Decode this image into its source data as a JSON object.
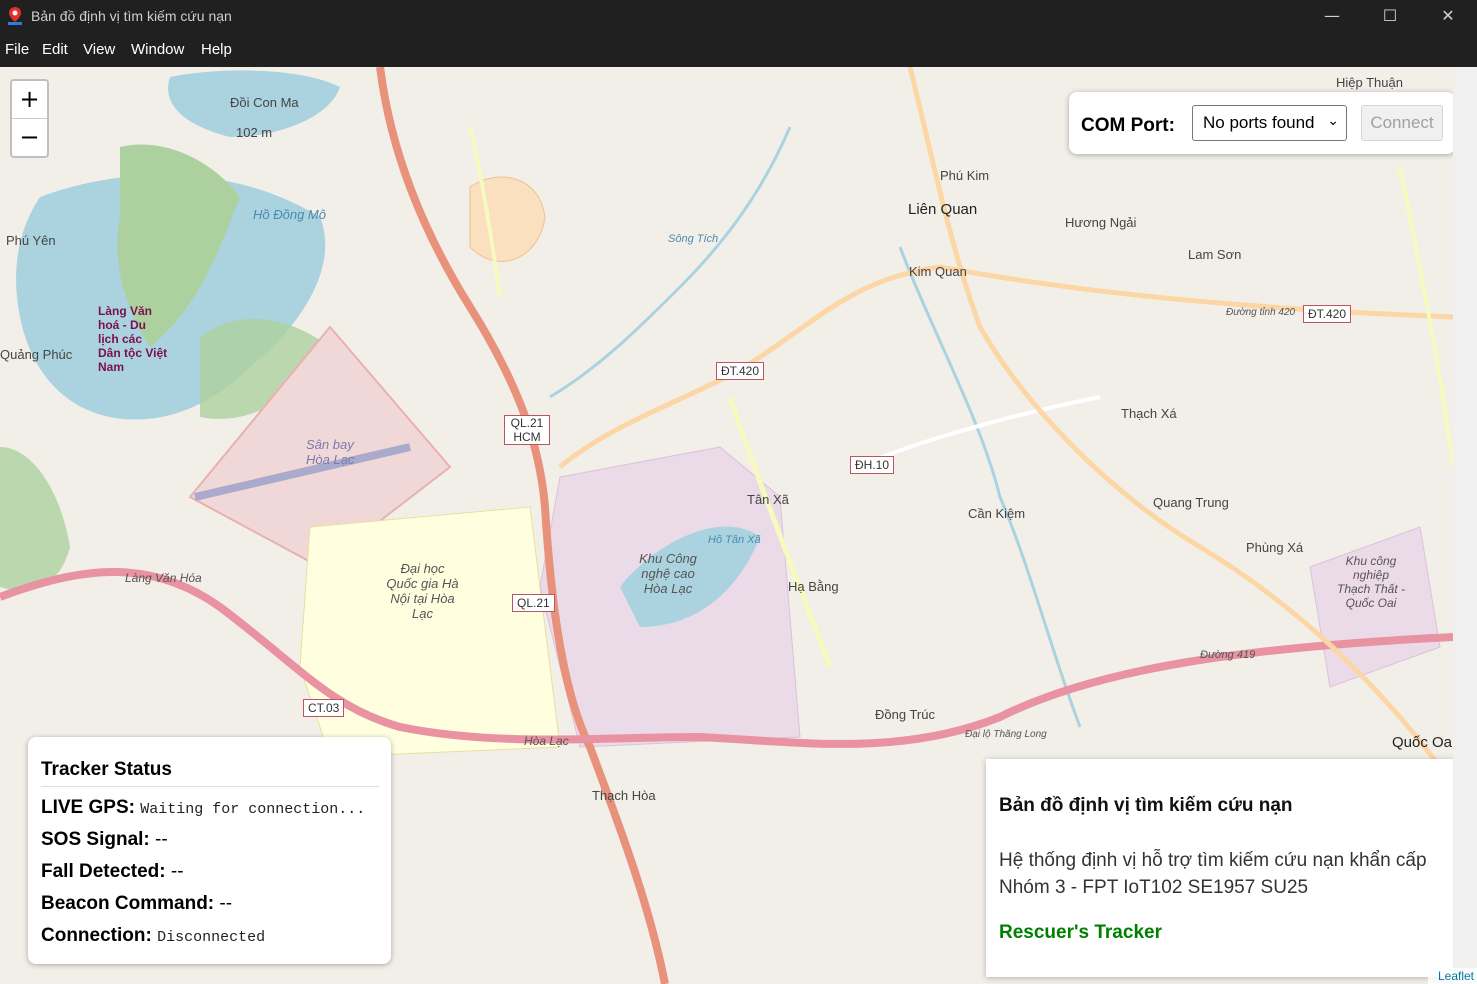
{
  "window": {
    "title": "Bản đồ định vị tìm kiếm cứu nạn",
    "controls": {
      "minimize": "—",
      "maximize": "☐",
      "close": "✕"
    }
  },
  "menu": {
    "items": [
      "File",
      "Edit",
      "View",
      "Window",
      "Help"
    ]
  },
  "map": {
    "zoom_in": "+",
    "zoom_out": "−",
    "places": [
      "Đồi Con Ma",
      "102 m",
      "Hồ Đồng Mô",
      "Phú Yên",
      "Làng Văn hoá - Du lịch các Dân tộc Việt Nam",
      "Quảng Phúc",
      "Sân bay Hòa Lạc",
      "Đại học Quốc gia Hà Nội tại Hòa Lạc",
      "Làng Văn Hóa",
      "Khu Công nghệ cao Hòa Lạc",
      "Hồ Tân Xã",
      "Tân Xã",
      "Hạ Bằng",
      "Phú Kim",
      "Liên Quan",
      "Kim Quan",
      "Hương Ngải",
      "Lam Sơn",
      "Thạch Xá",
      "Cần Kiệm",
      "Quang Trung",
      "Phùng Xá",
      "Đồng Trúc",
      "Thạch Hòa",
      "Hòa Lạc",
      "Hiệp Thuận",
      "Quốc Oai",
      "Sông Tích",
      "Đường tỉnh 420",
      "Đường 419",
      "Đại lộ Thăng Long",
      "Khu công nghiệp Thạch Thất - Quốc Oai"
    ],
    "road_shields": [
      "QL.21 HCM",
      "QL.21",
      "ĐT.420",
      "ĐH.10",
      "CT.03",
      "ĐT.420"
    ]
  },
  "com": {
    "label": "COM Port:",
    "select_value": "No ports found",
    "connect_label": "Connect"
  },
  "tracker": {
    "title": "Tracker Status",
    "live_gps_label": "LIVE GPS:",
    "live_gps_value": "Waiting for connection...",
    "sos_label": "SOS Signal:",
    "sos_value": "--",
    "fall_label": "Fall Detected:",
    "fall_value": "--",
    "beacon_label": "Beacon Command:",
    "beacon_value": "--",
    "connection_label": "Connection:",
    "connection_value": "Disconnected"
  },
  "info": {
    "title": "Bản đồ định vị tìm kiếm cứu nạn",
    "desc_line1": "Hệ thống định vị hỗ trợ tìm kiếm cứu nạn khẩn cấp",
    "desc_line2": "Nhóm 3 - FPT IoT102 SE1957 SU25",
    "link": "Rescuer's Tracker"
  },
  "attribution": "Leaflet",
  "colors": {
    "accent_green": "#008000",
    "titlebar": "#202020",
    "info_border": "#6ec3f2"
  }
}
